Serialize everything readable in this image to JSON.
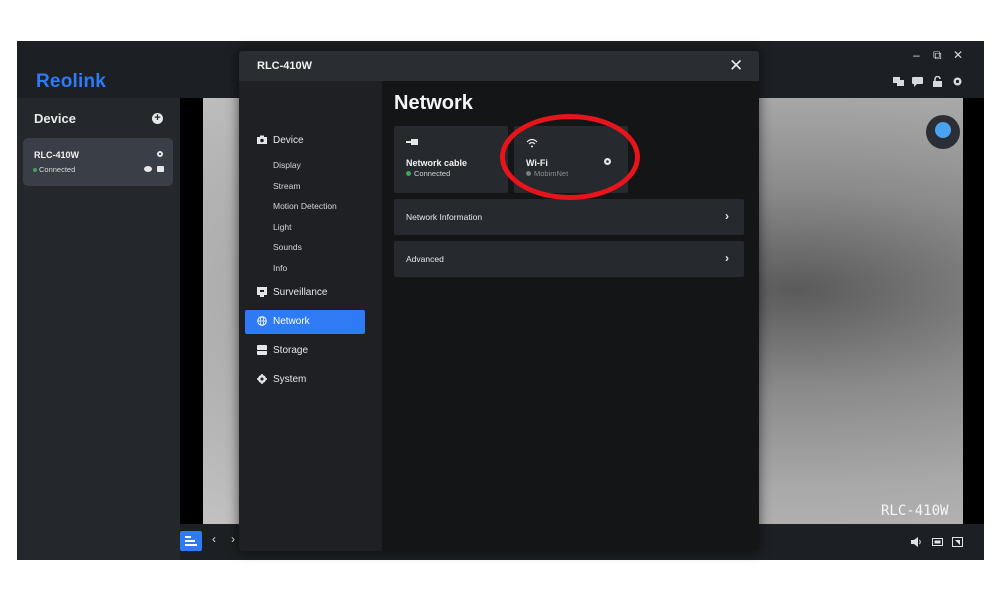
{
  "app": {
    "brand": "Reolink",
    "window_controls": [
      "–",
      "⧉",
      "✕"
    ]
  },
  "sidebar": {
    "title": "Device",
    "add_icon": "plus-icon",
    "device": {
      "name": "RLC-410W",
      "status": "Connected",
      "status_color": "#3ba55d"
    }
  },
  "live_view": {
    "watermark": "RLC-410W"
  },
  "modal": {
    "title": "RLC-410W",
    "close_label": "✕",
    "nav": {
      "device": "Device",
      "device_sub": [
        "Display",
        "Stream",
        "Motion Detection",
        "Light",
        "Sounds",
        "Info"
      ],
      "surveillance": "Surveillance",
      "network": "Network",
      "storage": "Storage",
      "system": "System"
    },
    "content": {
      "title": "Network",
      "cards": [
        {
          "name": "Network cable",
          "status": "Connected",
          "status_color": "#3ba55d",
          "status_text_color": "#cfd2d6",
          "icon": "ethernet-icon"
        },
        {
          "name": "Wi-Fi",
          "status": "MobimNet",
          "status_color": "#777b82",
          "status_text_color": "#8a8e95",
          "icon": "wifi-icon"
        }
      ],
      "rows": [
        "Network Information",
        "Advanced"
      ]
    }
  },
  "colors": {
    "accent": "#2f7bf5",
    "highlight": "#e8141b"
  }
}
